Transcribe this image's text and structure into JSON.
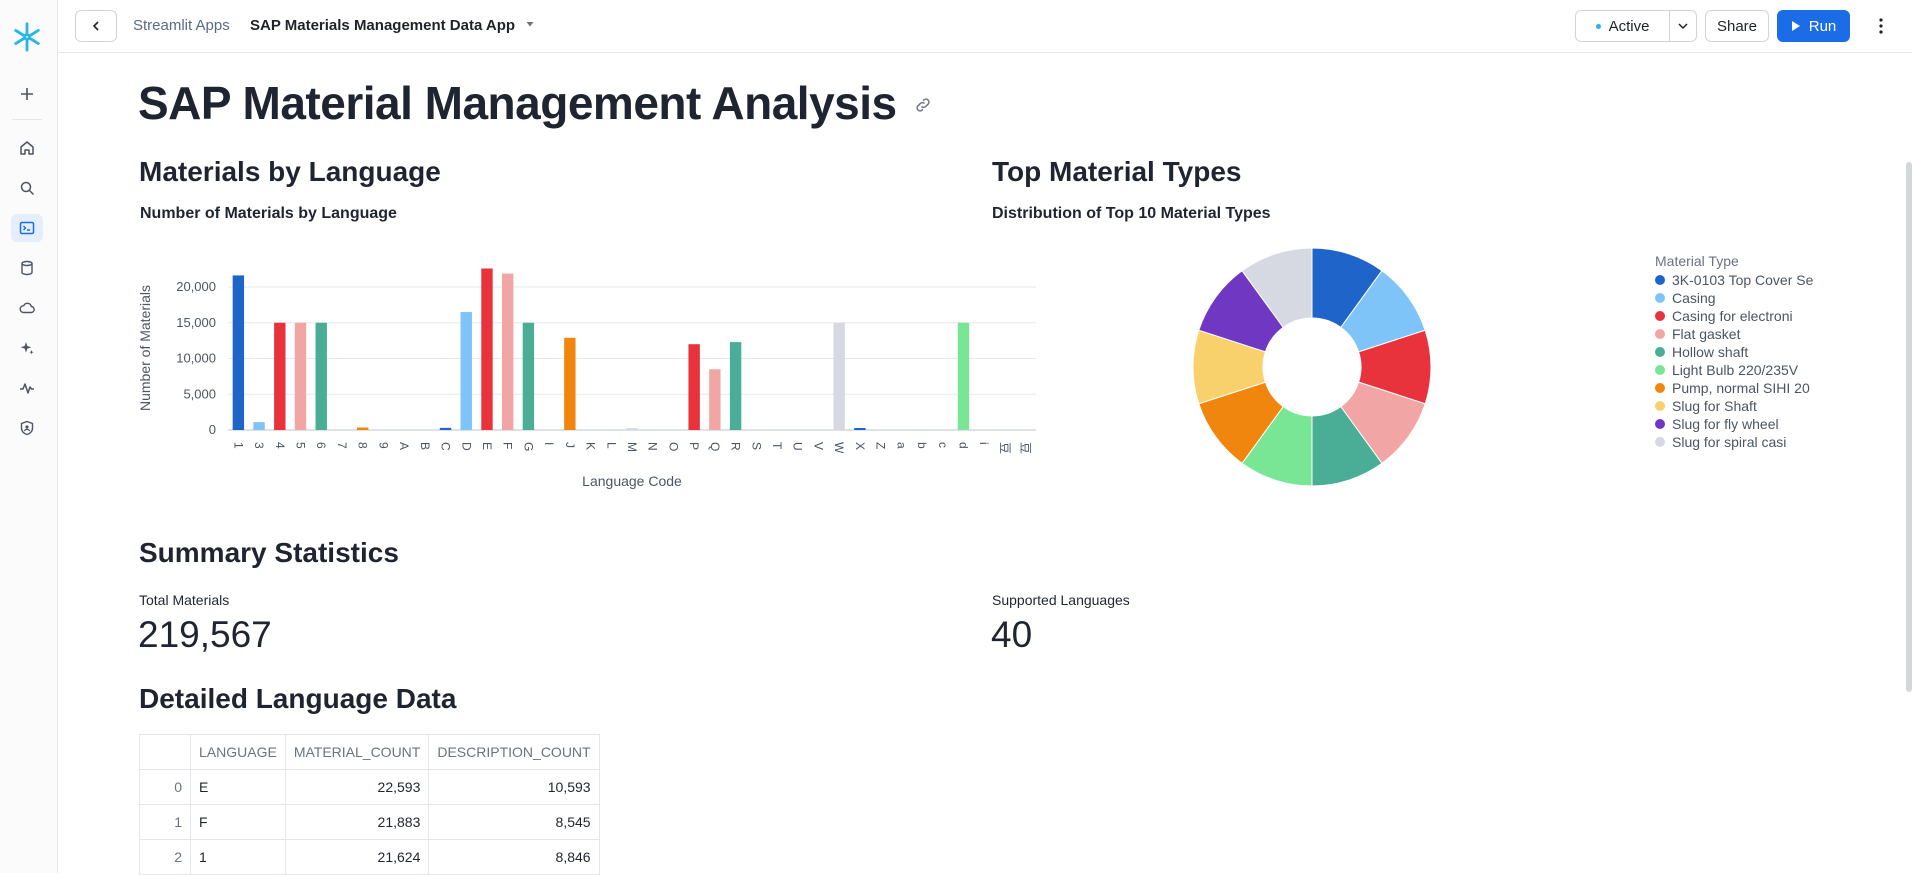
{
  "topbar": {
    "breadcrumb_apps": "Streamlit Apps",
    "app_name": "SAP Materials Management Data App",
    "status_label": "Active",
    "share_label": "Share",
    "run_label": "Run"
  },
  "nav_icons": [
    "snowflake-logo-icon",
    "plus-icon",
    "home-icon",
    "search-icon",
    "projects-icon",
    "data-icon",
    "cloud-icon",
    "ai-icon",
    "monitoring-icon",
    "admin-icon"
  ],
  "page": {
    "title": "SAP Material Management Analysis",
    "lang_header": "Materials by Language",
    "lang_subheader": "Number of Materials by Language",
    "types_header": "Top Material Types",
    "types_subheader": "Distribution of Top 10 Material Types",
    "summary_header": "Summary Statistics",
    "total_label": "Total Materials",
    "total_value": "219,567",
    "langs_label": "Supported Languages",
    "langs_value": "40",
    "detail_header": "Detailed Language Data"
  },
  "table": {
    "columns": [
      "",
      "LANGUAGE",
      "MATERIAL_COUNT",
      "DESCRIPTION_COUNT"
    ],
    "rows": [
      [
        "0",
        "E",
        "22,593",
        "10,593"
      ],
      [
        "1",
        "F",
        "21,883",
        "8,545"
      ],
      [
        "2",
        "1",
        "21,624",
        "8,846"
      ]
    ]
  },
  "colors": {
    "accent": "#1a6ce7",
    "palette": [
      "#1f64c8",
      "#7fc4f8",
      "#e8323c",
      "#f2a5a5",
      "#4aae96",
      "#78e694",
      "#f0860e",
      "#f8d06c",
      "#7038c2",
      "#d6d9e2"
    ]
  },
  "chart_data": [
    {
      "type": "bar",
      "title": "Number of Materials by Language",
      "xlabel": "Language Code",
      "ylabel": "Number of Materials",
      "ylim": [
        0,
        23500
      ],
      "yticks": [
        0,
        5000,
        10000,
        15000,
        20000
      ],
      "ytick_labels": [
        "0",
        "5,000",
        "10,000",
        "15,000",
        "20,000"
      ],
      "categories": [
        "1",
        "3",
        "4",
        "5",
        "6",
        "7",
        "8",
        "9",
        "A",
        "B",
        "C",
        "D",
        "E",
        "F",
        "G",
        "I",
        "J",
        "K",
        "L",
        "M",
        "N",
        "O",
        "P",
        "Q",
        "R",
        "S",
        "T",
        "U",
        "V",
        "W",
        "X",
        "Z",
        "a",
        "b",
        "c",
        "d",
        "i",
        "豆",
        "豆"
      ],
      "values": [
        21624,
        1100,
        15000,
        15000,
        15000,
        0,
        350,
        0,
        0,
        0,
        300,
        16500,
        22593,
        21883,
        15000,
        0,
        12900,
        0,
        0,
        200,
        0,
        0,
        12000,
        8500,
        12300,
        0,
        0,
        0,
        0,
        15000,
        150,
        0,
        0,
        0,
        0,
        15000,
        0,
        0,
        0
      ],
      "grid": true
    },
    {
      "type": "pie",
      "title": "Distribution of Top 10 Material Types",
      "legend_title": "Material Type",
      "legend_position": "right",
      "labels": [
        "3K-0103 Top Cover Se",
        "Casing",
        "Casing for electroni",
        "Flat gasket",
        "Hollow shaft",
        "Light Bulb 220/235V",
        "Pump, normal SIHI 20",
        "Slug for Shaft",
        "Slug for fly wheel",
        "Slug for spiral casi"
      ],
      "values": [
        10,
        10,
        10,
        10,
        10,
        10,
        10,
        10,
        10,
        10
      ],
      "donut": true
    }
  ]
}
